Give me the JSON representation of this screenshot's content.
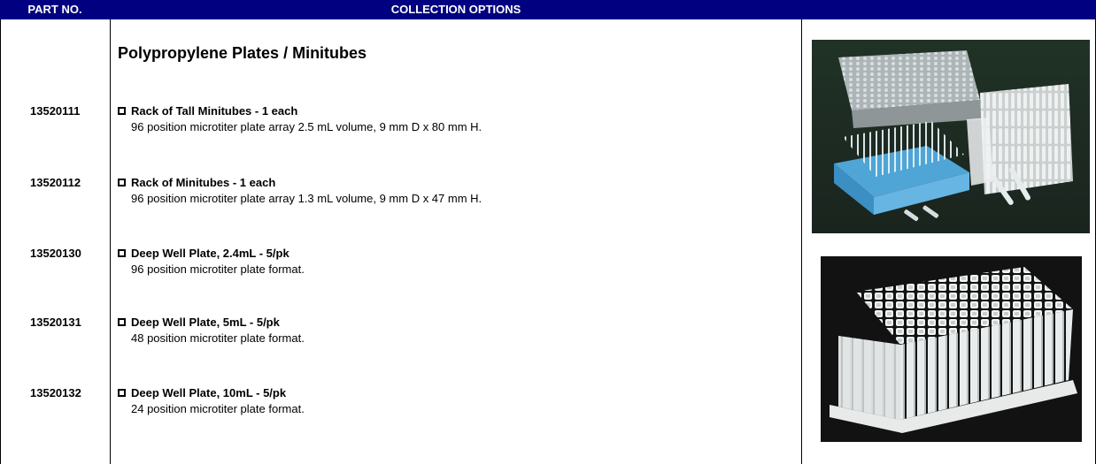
{
  "header": {
    "part_no_label": "PART NO.",
    "collection_options_label": "COLLECTION OPTIONS",
    "background_color": "#000080"
  },
  "section": {
    "title": "Polypropylene Plates / Minitubes"
  },
  "items": [
    {
      "part_no": "13520111",
      "name": "Rack of Tall Minitubes - 1 each",
      "description": "96 position microtiter plate array 2.5 mL volume, 9 mm D x 80 mm H."
    },
    {
      "part_no": "13520112",
      "name": "Rack of Minitubes - 1 each",
      "description": "96 position microtiter plate array 1.3 mL volume, 9 mm D x 47 mm H."
    },
    {
      "part_no": "13520130",
      "name": "Deep Well Plate, 2.4mL - 5/pk",
      "description": "96 position microtiter plate format."
    },
    {
      "part_no": "13520131",
      "name": "Deep Well Plate, 5mL - 5/pk",
      "description": "48 position microtiter plate format."
    },
    {
      "part_no": "13520132",
      "name": "Deep Well Plate, 10mL - 5/pk",
      "description": "24 position microtiter plate format."
    }
  ],
  "images": [
    {
      "subject": "minitube racks and tubes photo"
    },
    {
      "subject": "deep well plate photo"
    }
  ]
}
